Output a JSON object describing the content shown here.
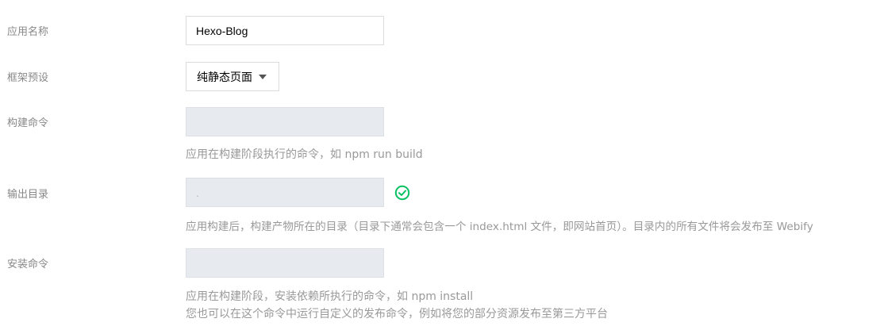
{
  "form": {
    "app_name": {
      "label": "应用名称",
      "value": "Hexo-Blog"
    },
    "framework": {
      "label": "框架预设",
      "selected": "纯静态页面"
    },
    "build_command": {
      "label": "构建命令",
      "value": "",
      "help": "应用在构建阶段执行的命令，如 npm run build"
    },
    "output_dir": {
      "label": "输出目录",
      "value": ".",
      "status": "valid",
      "help": "应用构建后，构建产物所在的目录（目录下通常会包含一个 index.html 文件，即网站首页）。目录内的所有文件将会发布至 Webify"
    },
    "install_command": {
      "label": "安装命令",
      "value": "",
      "help_line1": "应用在构建阶段，安装依赖所执行的命令，如 npm install",
      "help_line2": "您也可以在这个命令中运行自定义的发布命令，例如将您的部分资源发布至第三方平台"
    }
  },
  "colors": {
    "label": "#888888",
    "help": "#999999",
    "disabled_bg": "#e7eaef",
    "border": "#dcdcdc",
    "success": "#07c160"
  },
  "icons": {
    "status": "check-circle-icon",
    "dropdown": "caret-down-icon"
  }
}
